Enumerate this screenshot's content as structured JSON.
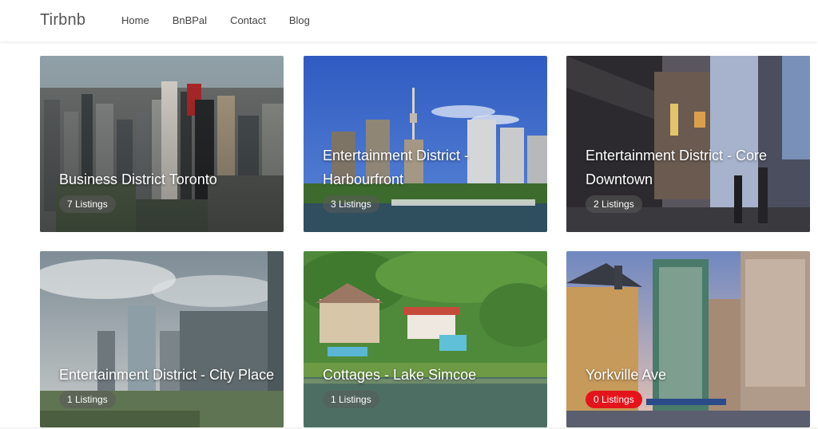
{
  "brand": "Tirbnb",
  "nav": [
    {
      "label": "Home"
    },
    {
      "label": "BnBPal"
    },
    {
      "label": "Contact"
    },
    {
      "label": "Blog"
    }
  ],
  "cards": [
    {
      "title": "Business District Toronto",
      "listings": "7 Listings",
      "image": "toronto-skyline-aerial"
    },
    {
      "title": "Entertainment District - Harbourfront",
      "listings": "3 Listings",
      "image": "cn-tower-harbour"
    },
    {
      "title": "Entertainment District - Core Downtown",
      "listings": "2 Listings",
      "image": "downtown-street-night"
    },
    {
      "title": "Entertainment District - City Place",
      "listings": "1 Listings",
      "image": "city-place-condos"
    },
    {
      "title": "Cottages - Lake Simcoe",
      "listings": "1 Listings",
      "image": "lakeside-cottage-aerial"
    },
    {
      "title": "Yorkville Ave",
      "listings": "0 Listings",
      "image": "yorkville-street",
      "badge_color": "#e4141b"
    }
  ]
}
